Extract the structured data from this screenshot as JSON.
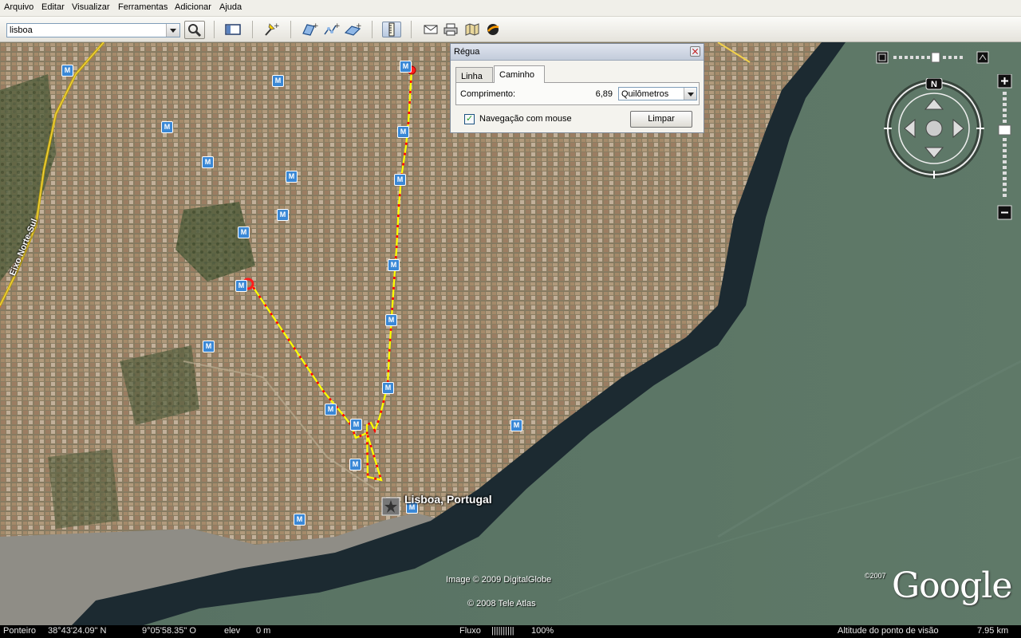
{
  "menu": [
    "Arquivo",
    "Editar",
    "Visualizar",
    "Ferramentas",
    "Adicionar",
    "Ajuda"
  ],
  "search": {
    "value": "lisboa"
  },
  "map": {
    "road_label": "Eixo Norte-Sul",
    "place_label": "Lisboa, Portugal",
    "credits": [
      "Image © 2009 DigitalGlobe",
      "© 2008 Tele Atlas"
    ],
    "logo_text": "Google",
    "logo_year": "©2007",
    "compass_north": "N",
    "metro_label": "M"
  },
  "ruler": {
    "title": "Régua",
    "tabs": [
      "Linha",
      "Caminho"
    ],
    "active_tab": "Caminho",
    "length_label": "Comprimento:",
    "length_value": "6,89",
    "unit": "Quilômetros",
    "mouse_nav_label": "Navegação com mouse",
    "mouse_nav_checked": true,
    "clear_label": "Limpar"
  },
  "status": {
    "pointer_label": "Ponteiro",
    "lat": "38°43'24.09\" N",
    "lon": "9°05'58.35\" O",
    "elev_label": "elev",
    "elev_value": "0 m",
    "stream_label": "Fluxo",
    "stream_bars": "||||||||||",
    "stream_value": "100%",
    "eye_alt_label": "Altitude do ponto de visão",
    "eye_alt_value": "7.95 km"
  },
  "colors": {
    "path": "#ffff00",
    "path_nodes": "#ff0000",
    "water": "#5c7462",
    "metro": "#3a88d6"
  }
}
